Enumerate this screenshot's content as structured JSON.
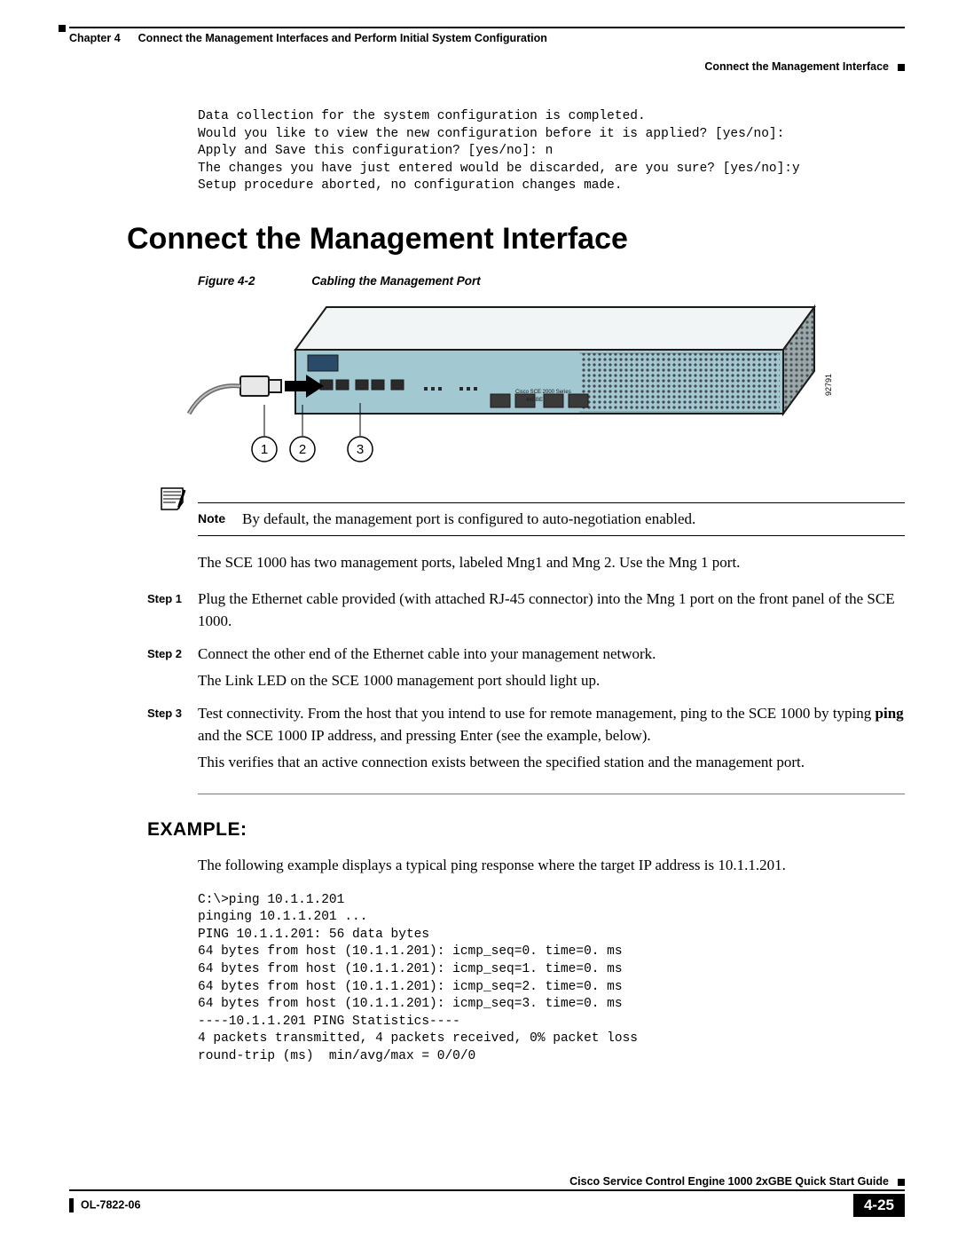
{
  "header": {
    "chapter": "Chapter 4",
    "title": "Connect the Management Interfaces and Perform Initial System Configuration",
    "subheader": "Connect the Management Interface"
  },
  "config_block": "Data collection for the system configuration is completed.\nWould you like to view the new configuration before it is applied? [yes/no]:\nApply and Save this configuration? [yes/no]: n\nThe changes you have just entered would be discarded, are you sure? [yes/no]:y\nSetup procedure aborted, no configuration changes made.",
  "section_title": "Connect the Management Interface",
  "figure": {
    "label": "Figure 4-2",
    "caption": "Cabling the Management Port",
    "id": "92791",
    "callouts": [
      "1",
      "2",
      "3"
    ]
  },
  "note": {
    "label": "Note",
    "text": "By default, the management port is configured to auto-negotiation enabled."
  },
  "intro_para": "The SCE 1000 has two management ports, labeled Mng1 and Mng 2. Use the Mng 1 port.",
  "steps": [
    {
      "label": "Step 1",
      "paras": [
        "Plug the Ethernet cable provided (with attached RJ-45 connector) into the Mng 1 port on the front panel of the SCE 1000."
      ]
    },
    {
      "label": "Step 2",
      "paras": [
        "Connect the other end of the Ethernet cable into your management network.",
        "The Link LED on the SCE 1000 management port should light up."
      ]
    },
    {
      "label": "Step 3",
      "paras": [
        "Test connectivity. From the host that you intend to use for remote management, ping to the SCE 1000 by typing <b>ping</b> and the SCE 1000 IP address, and pressing Enter (see the example, below).",
        "This verifies that an active connection exists between the specified station and the management port."
      ]
    }
  ],
  "example": {
    "title": "EXAMPLE:",
    "intro": "The following example displays a typical ping response where the target IP address is 10.1.1.201.",
    "block": "C:\\>ping 10.1.1.201\npinging 10.1.1.201 ...\nPING 10.1.1.201: 56 data bytes\n64 bytes from host (10.1.1.201): icmp_seq=0. time=0. ms\n64 bytes from host (10.1.1.201): icmp_seq=1. time=0. ms\n64 bytes from host (10.1.1.201): icmp_seq=2. time=0. ms\n64 bytes from host (10.1.1.201): icmp_seq=3. time=0. ms\n----10.1.1.201 PING Statistics----\n4 packets transmitted, 4 packets received, 0% packet loss\nround-trip (ms)  min/avg/max = 0/0/0"
  },
  "footer": {
    "guide": "Cisco Service Control Engine 1000 2xGBE Quick Start Guide",
    "docnum": "OL-7822-06",
    "page": "4-25"
  }
}
